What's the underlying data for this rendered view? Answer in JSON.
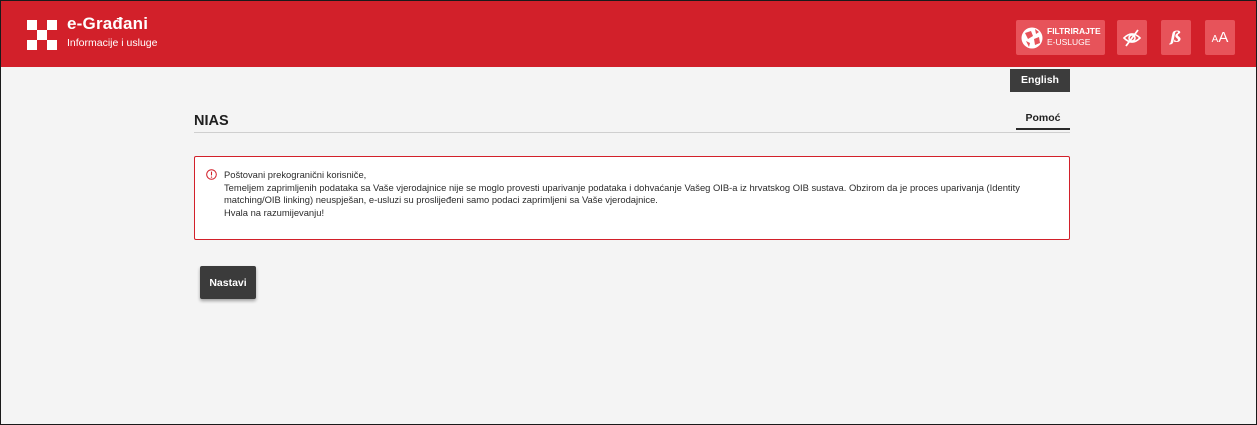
{
  "header": {
    "brand_title": "e-Građani",
    "brand_subtitle": "Informacije i usluge",
    "filter_button": {
      "line1": "FILTRIRAJTE",
      "line2": "E-USLUGE"
    },
    "dyslexia_button_label": "ß",
    "font_size_button": {
      "small": "A",
      "large": "A"
    }
  },
  "language_button": "English",
  "page": {
    "title": "NIAS",
    "help_link": "Pomoć"
  },
  "alert": {
    "lines": [
      "Poštovani prekogranični korisniče,",
      "Temeljem zaprimljenih podataka sa Vaše vjerodajnice nije se moglo provesti uparivanje podataka i dohvaćanje Vašeg OIB-a iz hrvatskog OIB sustava. Obzirom da je proces uparivanja (Identity matching/OIB linking) neuspješan, e-usluzi su proslijeđeni samo podaci zaprimljeni sa Vaše vjerodajnice.",
      "Hvala na razumijevanju!"
    ]
  },
  "continue_button": "Nastavi",
  "colors": {
    "brand_red": "#d2202a",
    "header_button": "#e7535a",
    "dark_button": "#3b3b3b"
  },
  "icons": [
    "checkered-logo-icon",
    "globe-ball-icon",
    "eye-slash-icon",
    "info-circle-icon"
  ]
}
